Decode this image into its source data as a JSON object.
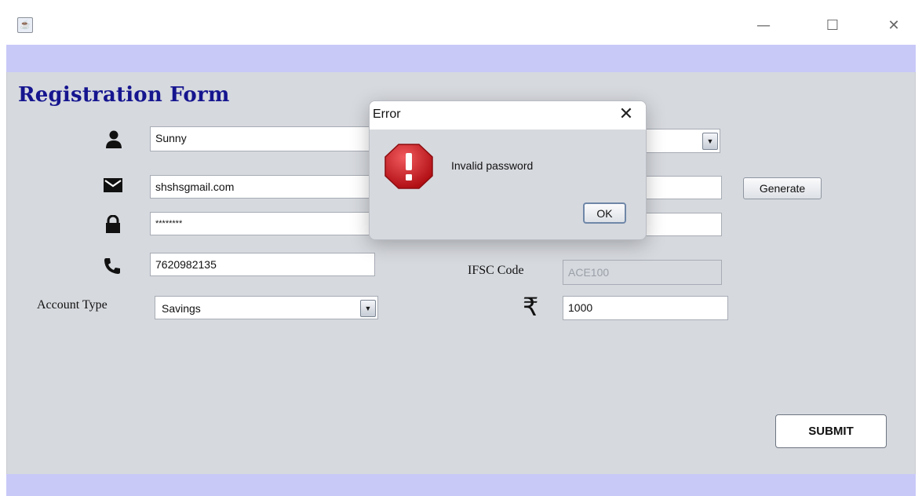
{
  "window": {
    "controls": {
      "minimize": "—",
      "maximize": "☐",
      "close": "✕"
    }
  },
  "form": {
    "heading": "Registration Form",
    "name_value": "Sunny",
    "email_value": "shshsgmail.com",
    "password_value": "********",
    "phone_value": "7620982135",
    "account_type_label": "Account Type",
    "account_type_value": "Savings",
    "generate_label": "Generate",
    "ifsc_label": "IFSC Code",
    "ifsc_value": "ACE100",
    "currency_symbol": "₹",
    "amount_value": "1000",
    "submit_label": "SUBMIT"
  },
  "dialog": {
    "title": "Error",
    "close_glyph": "✕",
    "message": "Invalid password",
    "ok_label": "OK"
  },
  "icons": {
    "user": "user-icon",
    "email": "envelope-icon",
    "password": "lock-icon",
    "phone": "phone-icon",
    "error": "error-octagon-icon"
  },
  "colors": {
    "heading": "#15158f",
    "band": "#c8c9f7",
    "error_octagon": "#c8161b"
  }
}
